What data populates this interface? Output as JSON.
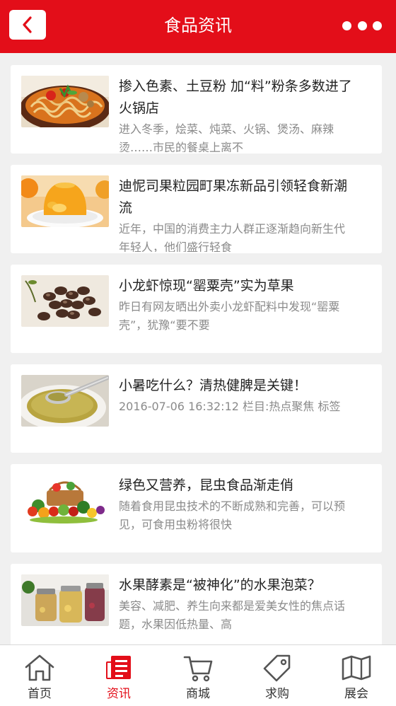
{
  "header": {
    "title": "食品资讯",
    "accent_color": "#e30e19",
    "back_icon": "chevron-left-icon",
    "more_icon": "more-dots-icon"
  },
  "articles": [
    {
      "title": "掺入色素、土豆粉 加“料”粉条多数进了火锅店",
      "desc": "进入冬季，烩菜、炖菜、火锅、煲汤、麻辣烫……市民的餐桌上离不",
      "image": "noodle-soup-photo"
    },
    {
      "title": "迪怩司果粒园町果冻新品引领轻食新潮流",
      "desc": "近年，中国的消费主力人群正逐渐趋向新生代年轻人，他们盛行轻食",
      "image": "mango-jelly-photo"
    },
    {
      "title": "小龙虾惊现“罂粟壳”实为草果",
      "desc": "昨日有网友晒出外卖小龙虾配料中发现“罂粟壳”，犹豫“要不要",
      "image": "tsaoko-fruit-photo"
    },
    {
      "title": "小暑吃什么？清热健脾是关键！",
      "desc": "2016-07-06 16:32:12 栏目:热点聚焦 标签",
      "image": "mung-bean-soup-photo"
    },
    {
      "title": "绿色又营养，昆虫食品渐走俏",
      "desc": "随着食用昆虫技术的不断成熟和完善，可以预见，可食用虫粉将很快",
      "image": "fruit-vegetable-basket-photo"
    },
    {
      "title": "水果酵素是“被神化”的水果泡菜？",
      "desc": "美容、减肥、养生向来都是爱美女性的焦点话题，水果因低热量、高",
      "image": "fruit-enzyme-jars-photo"
    }
  ],
  "tabbar": {
    "active_color": "#e30e19",
    "items": [
      {
        "label": "首页",
        "icon": "home-icon"
      },
      {
        "label": "资讯",
        "icon": "news-icon",
        "active": true
      },
      {
        "label": "商城",
        "icon": "cart-icon"
      },
      {
        "label": "求购",
        "icon": "tag-icon"
      },
      {
        "label": "展会",
        "icon": "map-icon"
      }
    ]
  }
}
